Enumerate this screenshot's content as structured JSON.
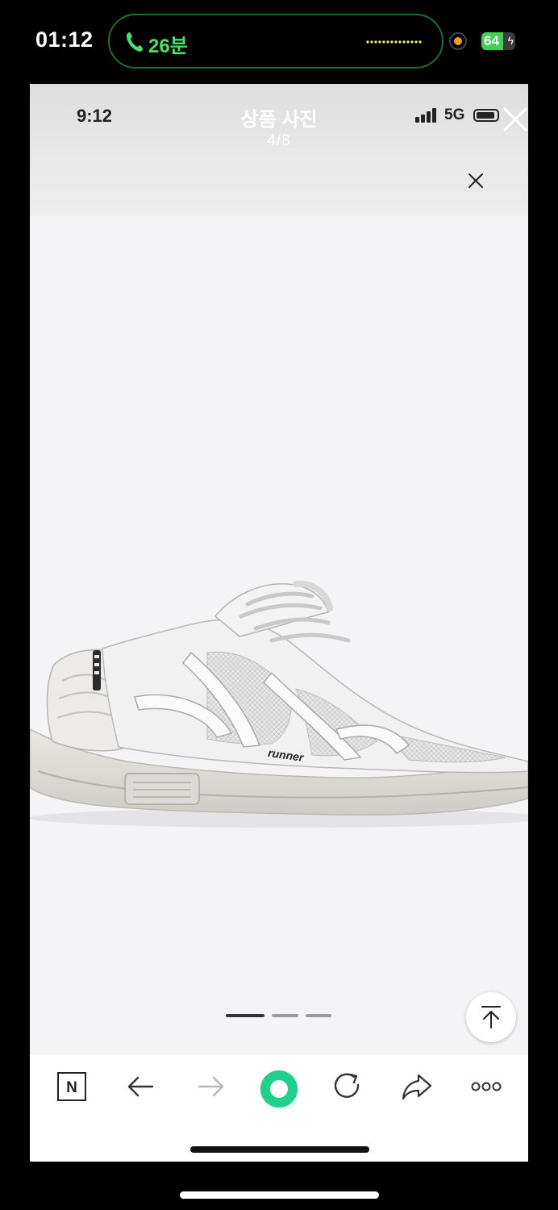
{
  "phone_status": {
    "time": "01:12",
    "call_duration": "26분",
    "battery": "64",
    "battery_level": 0.64
  },
  "inner_status": {
    "time": "9:12",
    "network": "5G"
  },
  "viewer": {
    "title": "상품 사진",
    "counter": "4/8"
  },
  "product": {
    "brand_text": "runner"
  },
  "carousel": {
    "count": 3,
    "active_index": 0
  },
  "toolbar": {
    "n_label": "N",
    "items": [
      "n-icon",
      "back-arrow-icon",
      "forward-arrow-icon",
      "home-ring-icon",
      "refresh-icon",
      "share-icon",
      "more-icon"
    ]
  },
  "colors": {
    "accent_green": "#1fd18b",
    "call_green": "#49e36a",
    "background": "#f4f3f5"
  }
}
